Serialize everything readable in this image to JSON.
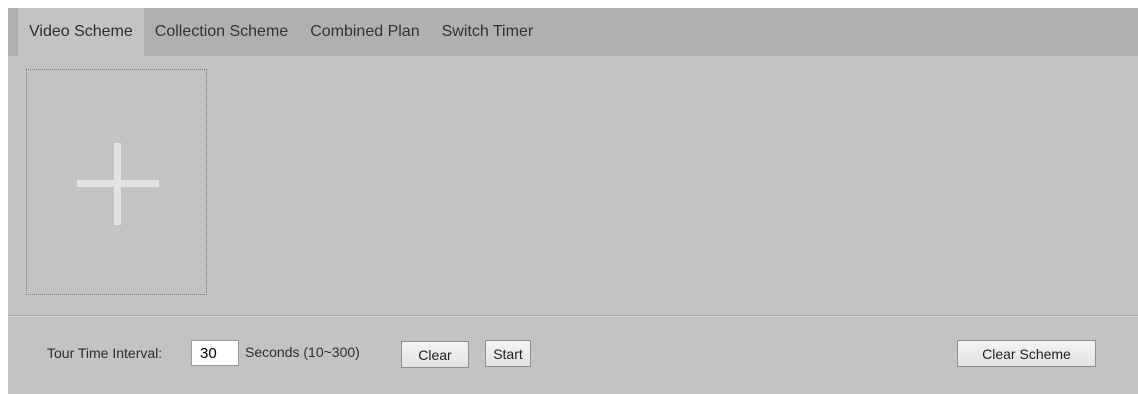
{
  "tabs": [
    {
      "label": "Video Scheme",
      "active": true
    },
    {
      "label": "Collection Scheme",
      "active": false
    },
    {
      "label": "Combined Plan",
      "active": false
    },
    {
      "label": "Switch Timer",
      "active": false
    }
  ],
  "add_tile": {
    "icon": "plus-icon"
  },
  "tour": {
    "label": "Tour Time Interval:",
    "value": "30",
    "unit": "Seconds (10~300)"
  },
  "buttons": {
    "clear": "Clear",
    "start": "Start",
    "clear_scheme": "Clear Scheme"
  },
  "colors": {
    "panel_background": "#c3c3c3",
    "tab_bar_background": "#b0b0b0",
    "plus_icon": "#e3e3e3"
  }
}
